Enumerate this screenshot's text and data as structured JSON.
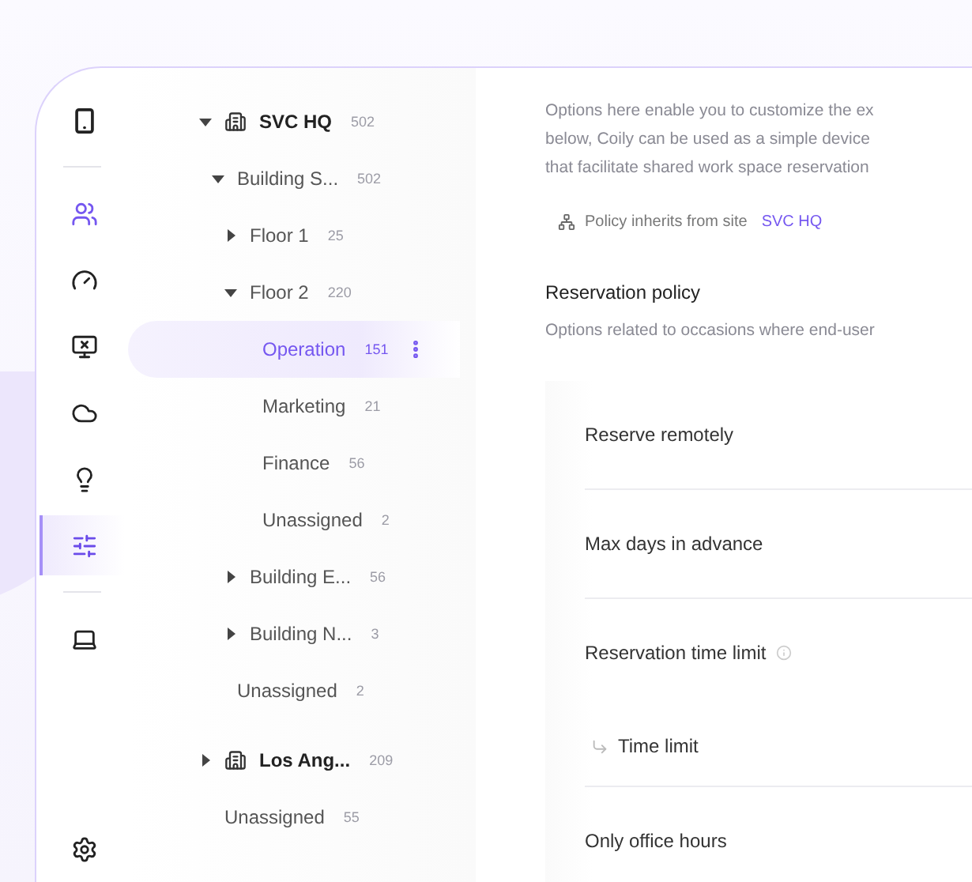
{
  "rail": {
    "groups": [
      {
        "items": [
          {
            "kind": "device",
            "selected": false
          }
        ]
      },
      {
        "items": [
          {
            "kind": "people",
            "selected": false
          },
          {
            "kind": "gauge",
            "selected": false
          },
          {
            "kind": "alert",
            "selected": false
          },
          {
            "kind": "cloud",
            "selected": false
          },
          {
            "kind": "bulb",
            "selected": false
          },
          {
            "kind": "policy",
            "selected": true
          }
        ]
      },
      {
        "items": [
          {
            "kind": "laptop",
            "selected": false
          }
        ]
      }
    ],
    "footer": {
      "items": [
        {
          "kind": "settings",
          "selected": false
        }
      ]
    }
  },
  "tree": [
    {
      "kind": "site",
      "label": "SVC HQ",
      "count": "502",
      "expanded": true,
      "selected": false,
      "children": [
        {
          "kind": "node",
          "label": "Building S...",
          "count": "502",
          "expanded": true,
          "selected": false,
          "children": [
            {
              "kind": "node",
              "label": "Floor 1",
              "count": "25",
              "expanded": false,
              "selected": false
            },
            {
              "kind": "node",
              "label": "Floor 2",
              "count": "220",
              "expanded": true,
              "selected": false,
              "children": [
                {
                  "kind": "leaf",
                  "label": "Operation",
                  "count": "151",
                  "selected": true
                },
                {
                  "kind": "leaf",
                  "label": "Marketing",
                  "count": "21",
                  "selected": false
                },
                {
                  "kind": "leaf",
                  "label": "Finance",
                  "count": "56",
                  "selected": false
                },
                {
                  "kind": "leaf",
                  "label": "Unassigned",
                  "count": "2",
                  "selected": false
                }
              ]
            },
            {
              "kind": "node",
              "label": "Building E...",
              "count": "56",
              "expanded": false,
              "selected": false
            },
            {
              "kind": "node",
              "label": "Building N...",
              "count": "3",
              "expanded": false,
              "selected": false
            }
          ]
        },
        {
          "kind": "leaf",
          "label": "Unassigned",
          "count": "2",
          "selected": false
        }
      ]
    },
    {
      "kind": "site",
      "label": "Los Ang...",
      "count": "209",
      "expanded": false,
      "selected": false
    },
    {
      "kind": "leaf",
      "label": "Unassigned",
      "count": "55",
      "selected": false
    }
  ],
  "content": {
    "intro_lines": [
      "Options here enable you to customize the ex",
      "below, Coily can be used as a simple device",
      "that facilitate shared work space reservation"
    ],
    "inherit": {
      "text": "Policy inherits from site",
      "link": "SVC HQ"
    },
    "section": {
      "title": "Reservation policy",
      "description": "Options related to occasions where end-user"
    },
    "settings": [
      {
        "kind": "setting",
        "label": "Reserve remotely",
        "info": false
      },
      {
        "kind": "setting",
        "label": "Max days in advance",
        "info": false
      },
      {
        "kind": "setting",
        "label": "Reservation time limit",
        "info": true
      },
      {
        "kind": "subsetting",
        "label": "Time limit",
        "info": false
      },
      {
        "kind": "setting",
        "label": "Only office hours",
        "info": false
      }
    ]
  }
}
